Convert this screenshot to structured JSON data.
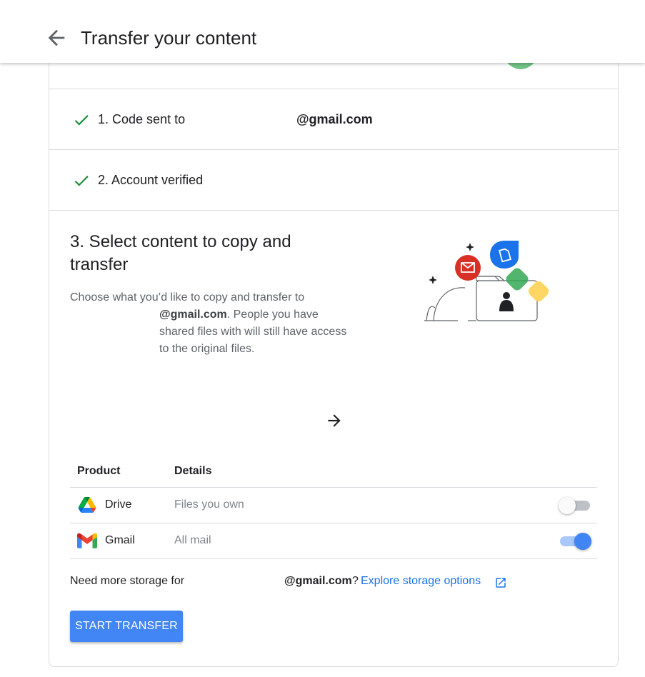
{
  "header": {
    "back_icon": "arrow-back-icon",
    "title": "Transfer your content"
  },
  "steps": [
    {
      "status_icon": "check-icon",
      "label": "1. Code sent to",
      "email": "@gmail.com"
    },
    {
      "status_icon": "check-icon",
      "label": "2. Account verified"
    }
  ],
  "step3": {
    "title": "3. Select content to copy and transfer",
    "desc_line1": "Choose what you’d like to copy and transfer to",
    "desc_email": "@gmail.com",
    "desc_rest": ". People you have shared files with will still have access to the original files.",
    "arrow_icon": "arrow-forward-icon"
  },
  "table": {
    "headers": [
      "Product",
      "Details"
    ],
    "rows": [
      {
        "product": "Drive",
        "icon": "google-drive-icon",
        "details": "Files you own",
        "enabled": false
      },
      {
        "product": "Gmail",
        "icon": "gmail-icon",
        "details": "All mail",
        "enabled": true
      }
    ]
  },
  "storage": {
    "prefix": "Need more storage for",
    "email": "@gmail.com",
    "question": "?",
    "link": "Explore storage options",
    "link_icon": "open-in-new-icon"
  },
  "start_button": "START TRANSFER",
  "colors": {
    "primary": "#4285f4",
    "link": "#1a73e8",
    "check": "#1e8e3e",
    "toggle_on_track": "#a8c7fa"
  }
}
